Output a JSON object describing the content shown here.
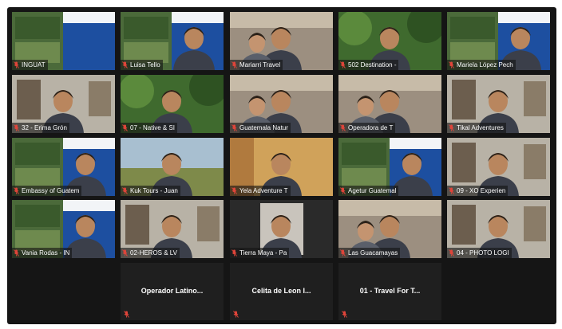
{
  "app": {
    "colors": {
      "background": "#151515",
      "active_speaker": "#d6e35a",
      "muted_icon": "#e0453a"
    }
  },
  "icons": {
    "muted": "mic-muted-icon"
  },
  "grid": {
    "rows": [
      [
        {
          "name": "INGUAT",
          "muted": true,
          "active": false,
          "kind": "slide"
        },
        {
          "name": "Luisa Tello",
          "muted": true,
          "active": false,
          "kind": "person-slide"
        },
        {
          "name": "Mariarri Travel",
          "muted": true,
          "active": false,
          "kind": "person-two"
        },
        {
          "name": "502 Destination -",
          "muted": true,
          "active": false,
          "kind": "person-green"
        },
        {
          "name": "Mariela López Pech",
          "muted": true,
          "active": true,
          "kind": "person-slide"
        }
      ],
      [
        {
          "name": "32 - Erima Grón",
          "muted": true,
          "active": false,
          "kind": "person-office"
        },
        {
          "name": "07 - Native & SI",
          "muted": true,
          "active": false,
          "kind": "person-plants"
        },
        {
          "name": "Guatemala Natur",
          "muted": true,
          "active": false,
          "kind": "person-two"
        },
        {
          "name": "Operadora de T",
          "muted": true,
          "active": false,
          "kind": "person-two"
        },
        {
          "name": "Tikal Adventures",
          "muted": true,
          "active": false,
          "kind": "person-office"
        }
      ],
      [
        {
          "name": "Embassy of Guatem",
          "muted": true,
          "active": false,
          "kind": "person-slide"
        },
        {
          "name": "Kuk Tours - Juan",
          "muted": true,
          "active": false,
          "kind": "person-field"
        },
        {
          "name": "Yela Adventure T",
          "muted": true,
          "active": false,
          "kind": "person-warm"
        },
        {
          "name": "Agetur Guatemal",
          "muted": true,
          "active": false,
          "kind": "person-slide"
        },
        {
          "name": "09 - XO Experien",
          "muted": true,
          "active": false,
          "kind": "person-office"
        }
      ],
      [
        {
          "name": "Vania Rodas - IN",
          "muted": true,
          "active": false,
          "kind": "person-slide"
        },
        {
          "name": "02-HEROS & LV",
          "muted": true,
          "active": false,
          "kind": "person-office"
        },
        {
          "name": "Tierra Maya - Pa",
          "muted": true,
          "active": false,
          "kind": "person-dark"
        },
        {
          "name": "Las Guacamayas",
          "muted": true,
          "active": false,
          "kind": "person-two"
        },
        {
          "name": "04 - PHOTO LOGI",
          "muted": true,
          "active": false,
          "kind": "person-office"
        }
      ]
    ],
    "blank_row": [
      {
        "name": "Operador  Latino...",
        "muted": true
      },
      {
        "name": "Celita de Leon I...",
        "muted": true
      },
      {
        "name": "01 - Travel For T...",
        "muted": true
      }
    ]
  }
}
